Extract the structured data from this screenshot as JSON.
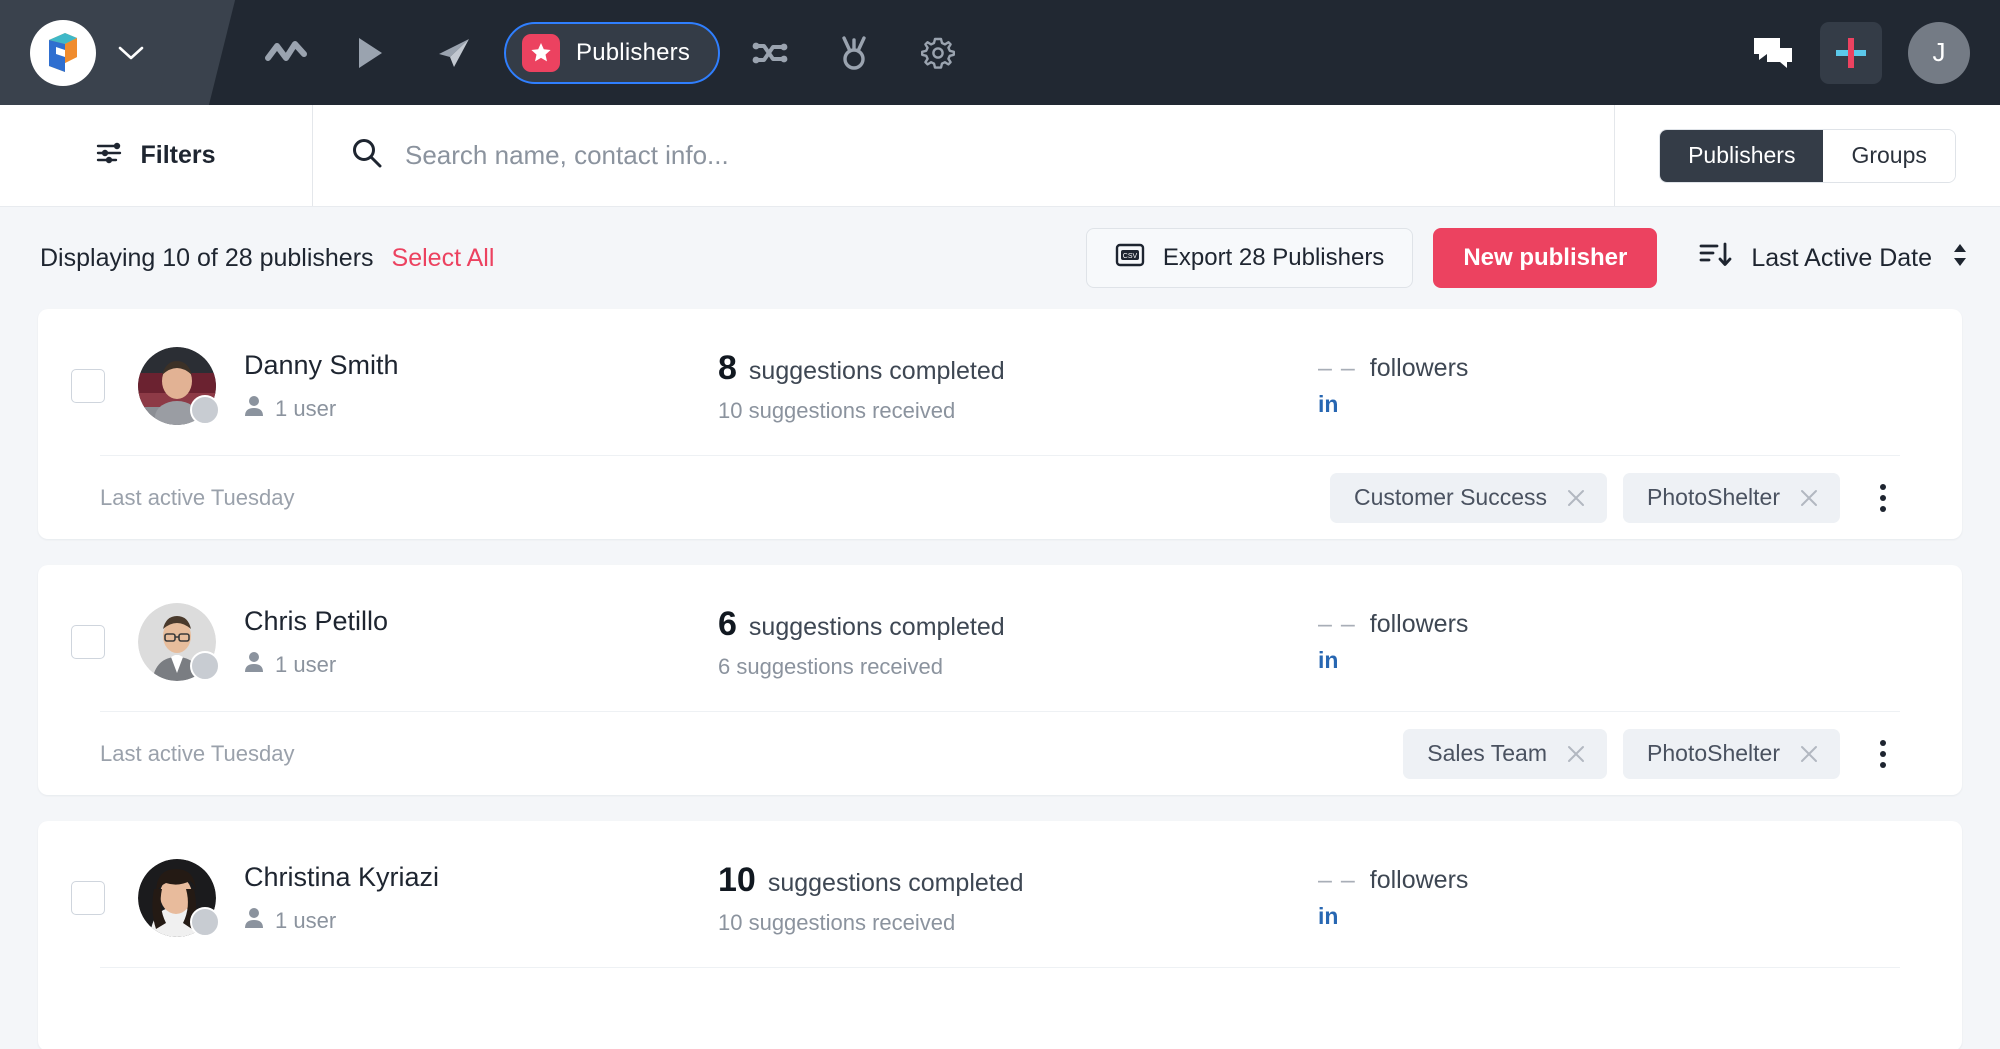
{
  "topnav": {
    "logo_name": "app-logo",
    "logo_caret": "chevron-down-icon",
    "icons": [
      {
        "name": "analytics-icon",
        "label": "Analytics"
      },
      {
        "name": "play-icon",
        "label": "Play"
      },
      {
        "name": "send-icon",
        "label": "Send"
      }
    ],
    "active_pill": {
      "label": "Publishers",
      "badge_icon": "star-icon",
      "badge_color": "#ec4260",
      "outline_color": "#2f7fff"
    },
    "icons_right_of_pill": [
      {
        "name": "shuffle-icon",
        "label": "Shuffle"
      },
      {
        "name": "medal-icon",
        "label": "Medal"
      },
      {
        "name": "gear-icon",
        "label": "Settings"
      }
    ],
    "chat_icon": "chat-icon",
    "plus_icon": "plus-icon",
    "plus_colors": {
      "vertical": "#ec4260",
      "horizontal": "#5bc8ea"
    },
    "avatar_initial": "J"
  },
  "search": {
    "filters_label": "Filters",
    "filters_icon": "sliders-icon",
    "search_icon": "search-icon",
    "placeholder": "Search name, contact info...",
    "value": "",
    "segments": [
      {
        "label": "Publishers",
        "active": true
      },
      {
        "label": "Groups",
        "active": false
      }
    ]
  },
  "toolbar": {
    "count_text": "Displaying 10 of 28 publishers",
    "select_all": "Select All",
    "export_label": "Export 28 Publishers",
    "export_icon": "csv-file-icon",
    "new_publisher_label": "New publisher",
    "new_publisher_color": "#ec4260",
    "sort_icon": "sort-descending-icon",
    "sort_label": "Last Active Date",
    "sort_toggle_icon": "up-down-caret-icon"
  },
  "publishers": [
    {
      "name": "Danny Smith",
      "users": "1 user",
      "suggestions_completed_count": "8",
      "suggestions_completed_label": "suggestions completed",
      "suggestions_received": "10 suggestions received",
      "followers_value": "– –",
      "followers_label": "followers",
      "social": "in",
      "last_active": "Last active Tuesday",
      "tags": [
        "Customer Success",
        "PhotoShelter"
      ],
      "avatar_style": "photo-male-1"
    },
    {
      "name": "Chris Petillo",
      "users": "1 user",
      "suggestions_completed_count": "6",
      "suggestions_completed_label": "suggestions completed",
      "suggestions_received": "6 suggestions received",
      "followers_value": "– –",
      "followers_label": "followers",
      "social": "in",
      "last_active": "Last active Tuesday",
      "tags": [
        "Sales Team",
        "PhotoShelter"
      ],
      "avatar_style": "photo-male-2"
    },
    {
      "name": "Christina Kyriazi",
      "users": "1 user",
      "suggestions_completed_count": "10",
      "suggestions_completed_label": "suggestions completed",
      "suggestions_received": "10 suggestions received",
      "followers_value": "– –",
      "followers_label": "followers",
      "social": "in",
      "last_active": "",
      "tags": [],
      "avatar_style": "photo-female-1"
    }
  ]
}
